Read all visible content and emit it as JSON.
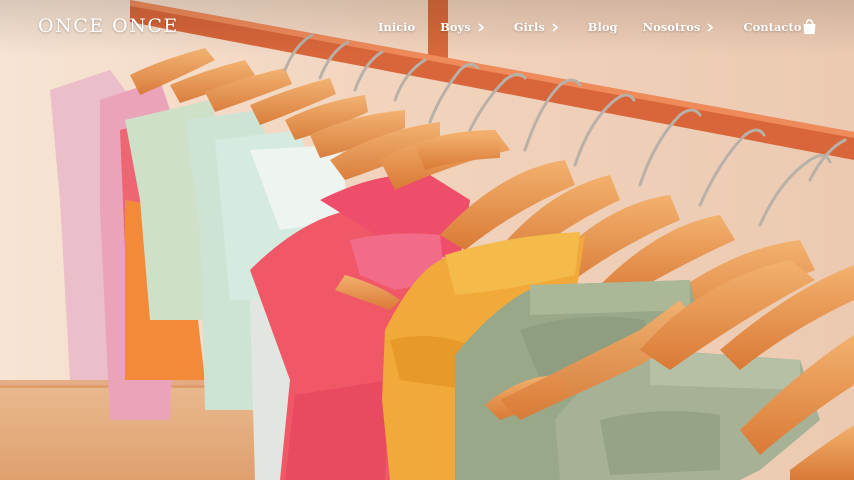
{
  "brand": {
    "logo_text": "ONCE ONCE"
  },
  "nav": {
    "items": [
      {
        "label": "Inicio",
        "has_dropdown": false
      },
      {
        "label": "Boys",
        "has_dropdown": true
      },
      {
        "label": "Girls",
        "has_dropdown": true
      },
      {
        "label": "Blog",
        "has_dropdown": false
      },
      {
        "label": "Nosotros",
        "has_dropdown": true
      },
      {
        "label": "Contacto",
        "has_dropdown": false
      }
    ],
    "cart_icon": "shopping-bag-icon",
    "dropdown_icon": "chevron-right-icon"
  },
  "hero": {
    "image_subject": "children's clothes on wooden hangers"
  },
  "colors": {
    "nav_text": "#ffffff",
    "rail": "#d9693a",
    "wall": "#f2d6c2",
    "hanger_wood": "#e9944a"
  }
}
